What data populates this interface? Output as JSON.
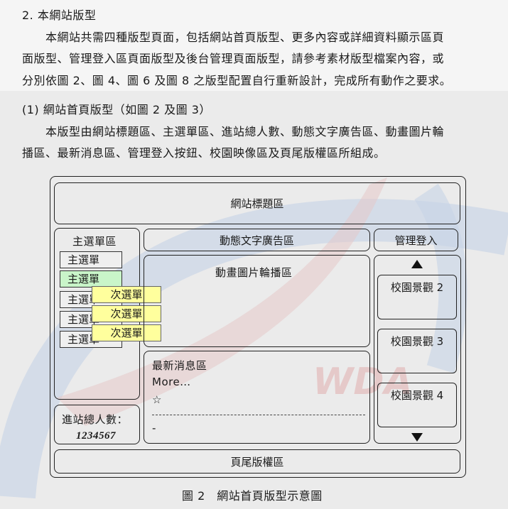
{
  "section": {
    "heading": "2.  本網站版型",
    "para1_line1": "本網站共需四種版型頁面，包括網站首頁版型、更多內容或詳細資料顯示區頁",
    "para1_line2": "面版型、管理登入區頁面版型及後台管理頁面版型，請參考素材版型檔案內容，或",
    "para1_line3": "分別依圖 2、圖 4、圖 6 及圖 8 之版型配置自行重新設計，完成所有動作之要求。"
  },
  "subsection": {
    "heading": "(1)  網站首頁版型（如圖 2 及圖 3）",
    "para_line1": "本版型由網站標題區、主選單區、進站總人數、動態文字廣告區、動畫圖片輪",
    "para_line2": "播區、最新消息區、管理登入按鈕、校園映像區及頁尾版權區所組成。"
  },
  "diagram": {
    "title_area": "網站標題區",
    "main_menu_area": "主選單區",
    "menu_items": [
      "主選單",
      "主選單",
      "主選單",
      "主選單",
      "主選單"
    ],
    "submenu_items": [
      "次選單",
      "次選單",
      "次選單"
    ],
    "visitor_label": "進站總人數：",
    "visitor_count": "1234567",
    "marquee_area": "動態文字廣告區",
    "slideshow_area": "動畫圖片輪播區",
    "news_title": "最新消息區",
    "news_more": "More…",
    "news_star": "☆",
    "news_dash": "-",
    "admin_login": "管理登入",
    "scenes": [
      "校園景觀 2",
      "校園景觀 3",
      "校園景觀 4"
    ],
    "footer_area": "頁尾版權區",
    "caption": "圖 2　網站首頁版型示意圖"
  },
  "watermark": {
    "text": "WDA"
  }
}
